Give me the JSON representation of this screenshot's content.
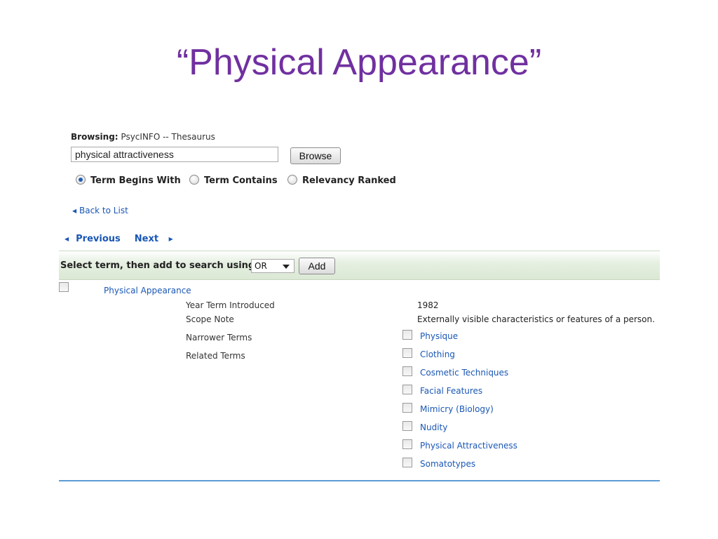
{
  "slide": {
    "title": "“Physical Appearance”"
  },
  "browse": {
    "label": "Browsing:",
    "database": "PsycINFO -- Thesaurus",
    "query": "physical attractiveness",
    "button_label": "Browse",
    "options": [
      {
        "label": "Term Begins With",
        "selected": true
      },
      {
        "label": "Term Contains",
        "selected": false
      },
      {
        "label": "Relevancy Ranked",
        "selected": false
      }
    ]
  },
  "nav": {
    "back_label": "Back to List",
    "previous_label": "Previous",
    "next_label": "Next"
  },
  "toolbar": {
    "label": "Select term, then add to search using:",
    "operator": "OR",
    "add_label": "Add"
  },
  "term": {
    "name": "Physical Appearance",
    "details": [
      {
        "label": "Year Term Introduced",
        "value": "1982"
      },
      {
        "label": "Scope Note",
        "value": "Externally visible characteristics or features of a person."
      },
      {
        "label": "Narrower Terms",
        "value": ""
      },
      {
        "label": "Related Terms",
        "value": ""
      }
    ],
    "related_terms": [
      "Physique",
      "Clothing",
      "Cosmetic Techniques",
      "Facial Features",
      "Mimicry (Biology)",
      "Nudity",
      "Physical Attractiveness",
      "Somatotypes"
    ]
  },
  "colors": {
    "title": "#7030a0",
    "link": "#1a57b5",
    "bar": "#dbe8d4",
    "rule": "#5b9bd5"
  }
}
